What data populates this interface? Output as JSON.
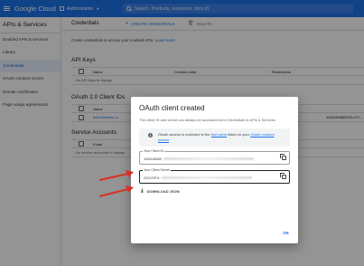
{
  "topbar": {
    "brand": "Google Cloud",
    "project": "Authorization",
    "search_placeholder": "Search  Products, resources, docs (/)"
  },
  "sidebar": {
    "title": "APIs & Services",
    "items": [
      {
        "label": "Enabled APIs & services",
        "active": false
      },
      {
        "label": "Library",
        "active": false
      },
      {
        "label": "Credentials",
        "active": true
      },
      {
        "label": "OAuth consent screen",
        "active": false
      },
      {
        "label": "Domain verification",
        "active": false
      },
      {
        "label": "Page usage agreements",
        "active": false
      }
    ]
  },
  "header": {
    "title": "Credentials",
    "create_label": "CREATE CREDENTIALS",
    "delete_label": "DELETE"
  },
  "description": {
    "text": "Create credentials to access your enabled APIs.",
    "link": "Learn more"
  },
  "api_keys": {
    "title": "API Keys",
    "columns": [
      "Name",
      "Creation date",
      "Restrictions"
    ],
    "empty": "No API keys to display"
  },
  "oauth": {
    "title": "OAuth 2.0 Client IDs",
    "columns": [
      "Name"
    ],
    "row_name": "test.bitrixlabs.ru",
    "row_client_id": "1064189862490-s70..."
  },
  "service_accounts": {
    "title": "Service Accounts",
    "columns": [
      "Email"
    ],
    "empty": "No service accounts to display"
  },
  "dialog": {
    "title": "OAuth client created",
    "description": "The client ID and secret can always be accessed from Credentials in APIs & Services",
    "notice_prefix": "OAuth access is restricted to the",
    "notice_link1": "test users",
    "notice_middle": "listed on your",
    "notice_link2": "OAuth consent screen",
    "client_id_label": "Your Client ID",
    "client_id_value": "106418862",
    "client_secret_label": "Your Client Secret",
    "client_secret_value": "GOCSPX-",
    "download_label": "DOWNLOAD JSON",
    "ok_label": "OK"
  },
  "colors": {
    "accent": "#1a73e8",
    "arrow": "#d93025"
  }
}
